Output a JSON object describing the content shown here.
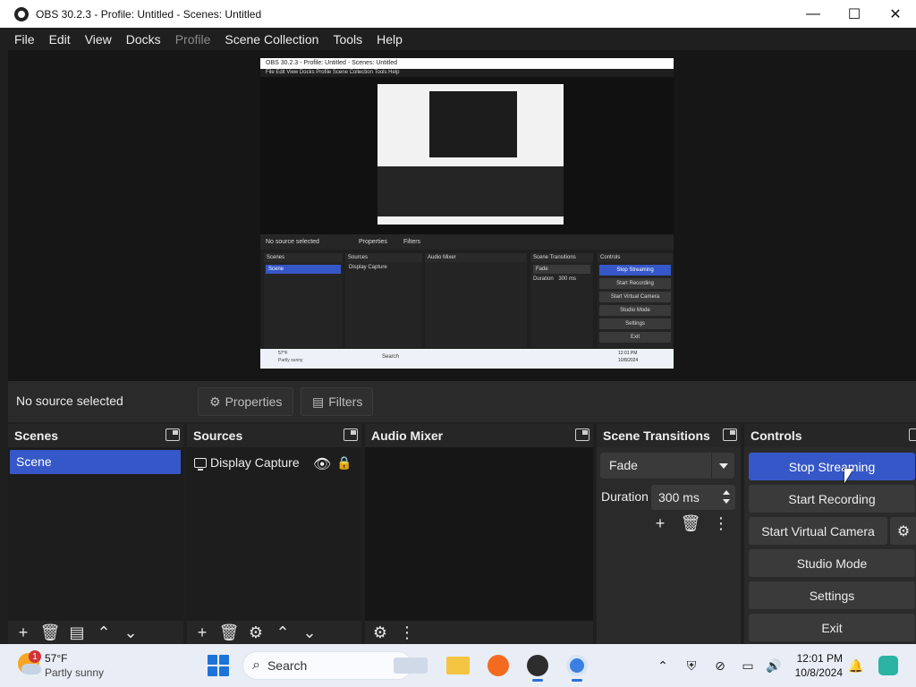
{
  "window": {
    "title": "OBS 30.2.3 - Profile: Untitled - Scenes: Untitled",
    "minimize": "—",
    "maximize": "☐",
    "close": "✕"
  },
  "menu": [
    {
      "label": "File",
      "enabled": true
    },
    {
      "label": "Edit",
      "enabled": true
    },
    {
      "label": "View",
      "enabled": true
    },
    {
      "label": "Docks",
      "enabled": true
    },
    {
      "label": "Profile",
      "enabled": false
    },
    {
      "label": "Scene Collection",
      "enabled": true
    },
    {
      "label": "Tools",
      "enabled": true
    },
    {
      "label": "Help",
      "enabled": true
    }
  ],
  "preview": {
    "title": "OBS 30.2.3 - Profile: Untitled - Scenes: Untitled",
    "menu": "File  Edit  View  Docks  Profile  Scene Collection  Tools  Help",
    "no_source": "No source selected",
    "properties": "Properties",
    "filters": "Filters",
    "scenes": "Scenes",
    "sources": "Sources",
    "audio_mixer": "Audio Mixer",
    "scene_transitions": "Scene Transitions",
    "controls": "Controls",
    "scene": "Scene",
    "display_capture": "Display Capture",
    "fade": "Fade",
    "duration": "Duration",
    "duration_value": "300 ms",
    "buttons": [
      "Stop Streaming",
      "Start Recording",
      "Start Virtual Camera",
      "Studio Mode",
      "Settings",
      "Exit"
    ],
    "weather_temp": "57°F",
    "weather_cond": "Partly sunny",
    "search": "Search",
    "time": "12:01 PM",
    "date": "10/8/2024"
  },
  "source_toolbar": {
    "no_source": "No source selected",
    "properties": "Properties",
    "filters": "Filters"
  },
  "docks": {
    "scenes": {
      "title": "Scenes",
      "items": [
        "Scene"
      ]
    },
    "sources": {
      "title": "Sources",
      "items": [
        {
          "name": "Display Capture"
        }
      ]
    },
    "audio_mixer": {
      "title": "Audio Mixer"
    },
    "transitions": {
      "title": "Scene Transitions",
      "selected": "Fade",
      "duration_label": "Duration",
      "duration_value": "300 ms"
    },
    "controls": {
      "title": "Controls",
      "stop_streaming": "Stop Streaming",
      "start_recording": "Start Recording",
      "start_virtual_camera": "Start Virtual Camera",
      "studio_mode": "Studio Mode",
      "settings": "Settings",
      "exit": "Exit"
    }
  },
  "taskbar": {
    "weather_temp": "57°F",
    "weather_cond": "Partly sunny",
    "weather_badge": "1",
    "search": "Search",
    "time": "12:01 PM",
    "date": "10/8/2024"
  },
  "colors": {
    "accent": "#3657c7",
    "background": "#1f1f1f",
    "panel": "#2a2a2a"
  }
}
